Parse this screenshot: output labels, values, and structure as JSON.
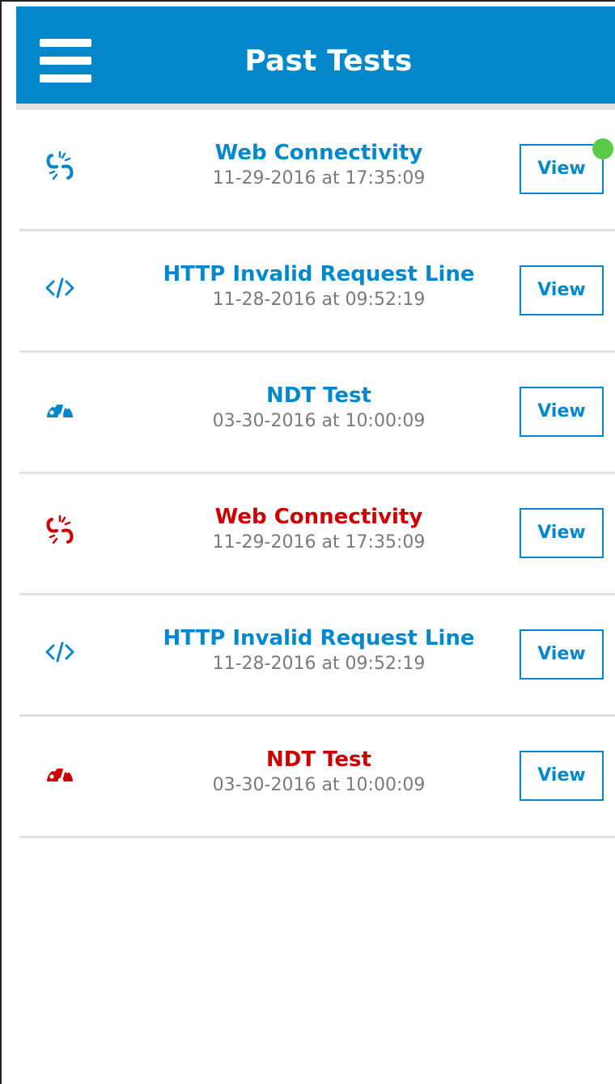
{
  "header": {
    "title": "Past Tests",
    "background_color": "#0588CB",
    "menu_icon": "hamburger-menu-icon"
  },
  "colors": {
    "ok": "#0588CB",
    "failed": "#CC0000",
    "date_text": "#7a7a7a",
    "new_indicator": "#5CC94A"
  },
  "tests": [
    {
      "name": "Web Connectivity",
      "date": "11-29-2016 at 17:35:09",
      "icon": "broken-link-icon",
      "status": "ok",
      "view_label": "View",
      "new": true
    },
    {
      "name": "HTTP Invalid Request Line",
      "date": "11-28-2016 at 09:52:19",
      "icon": "code-brackets-icon",
      "status": "ok",
      "view_label": "View",
      "new": false
    },
    {
      "name": "NDT Test",
      "date": "03-30-2016 at 10:00:09",
      "icon": "speedometer-icon",
      "status": "ok",
      "view_label": "View",
      "new": false
    },
    {
      "name": "Web Connectivity",
      "date": "11-29-2016 at 17:35:09",
      "icon": "broken-link-icon",
      "status": "failed",
      "view_label": "View",
      "new": false
    },
    {
      "name": "HTTP Invalid Request Line",
      "date": "11-28-2016 at 09:52:19",
      "icon": "code-brackets-icon",
      "status": "ok",
      "view_label": "View",
      "new": false
    },
    {
      "name": "NDT Test",
      "date": "03-30-2016 at 10:00:09",
      "icon": "speedometer-icon",
      "status": "failed",
      "view_label": "View",
      "new": false
    }
  ]
}
